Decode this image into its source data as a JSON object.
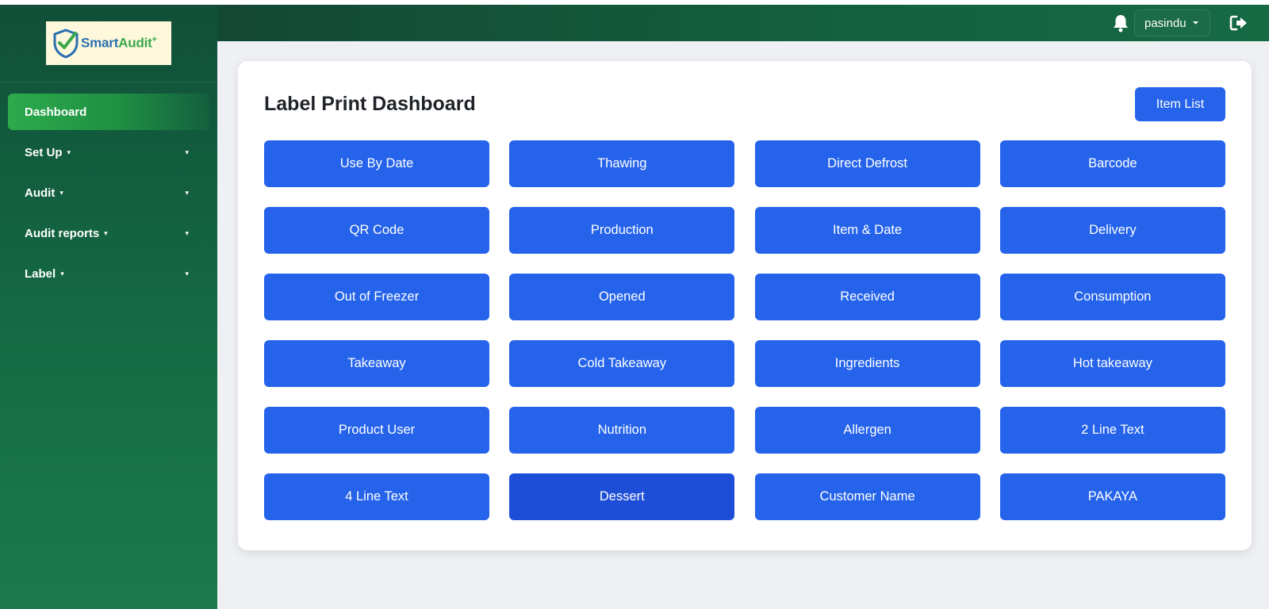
{
  "logo": {
    "brand_part1": "Smart",
    "brand_part2": "Audit",
    "plus": "+"
  },
  "sidebar": {
    "items": [
      {
        "label": "Dashboard",
        "active": true
      },
      {
        "label": "Set Up",
        "caret": "▾",
        "expand": "▾"
      },
      {
        "label": "Audit",
        "caret": "▾",
        "expand": "▾"
      },
      {
        "label": "Audit reports",
        "caret": "▾",
        "expand": "▾"
      },
      {
        "label": "Label",
        "caret": "▾",
        "expand": "▾"
      }
    ]
  },
  "topbar": {
    "icons": [
      "bell-icon",
      "logout-icon"
    ],
    "user": {
      "name": "pasindu",
      "caret": "⏷"
    }
  },
  "dashboard": {
    "title": "Label Print Dashboard",
    "item_list_label": "Item List",
    "buttons": [
      "Use By Date",
      "Thawing",
      "Direct Defrost",
      "Barcode",
      "QR Code",
      "Production",
      "Item & Date",
      "Delivery",
      "Out of Freezer",
      "Opened",
      "Received",
      "Consumption",
      "Takeaway",
      "Cold Takeaway",
      "Ingredients",
      "Hot takeaway",
      "Product User",
      "Nutrition",
      "Allergen",
      "2 Line Text",
      "4 Line Text",
      "Dessert",
      "Customer Name",
      "PAKAYA"
    ],
    "hovered_button": "Dessert"
  },
  "colors": {
    "sidebar_top": "#114f38",
    "sidebar_active": "#2cab4c",
    "topbar": "#134834",
    "button_blue": "#2563eb",
    "button_hover": "#1d4ed8",
    "background": "#eef0f3"
  }
}
